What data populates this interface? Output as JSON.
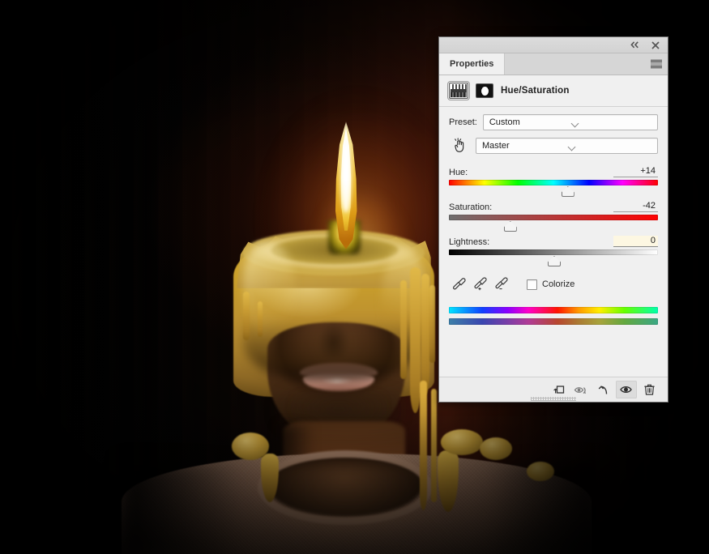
{
  "app": {
    "panel_title": "Properties",
    "titlebar": {
      "collapse_icon": "double-left-chevron-icon",
      "close_icon": "close-icon",
      "menu_icon": "panel-menu-icon"
    }
  },
  "adjustment": {
    "icon_adjustment": "hue-saturation-adjustment-icon",
    "icon_mask": "layer-mask-icon",
    "title": "Hue/Saturation"
  },
  "preset": {
    "label": "Preset:",
    "value": "Custom",
    "caret_icon": "chevron-down-icon"
  },
  "channel": {
    "targeted_adjustment_icon": "on-image-adjustment-hand-icon",
    "value": "Master",
    "caret_icon": "chevron-down-icon"
  },
  "sliders": [
    {
      "label": "Hue:",
      "value": "+14",
      "thumb_pct": 56.5,
      "highlight": false
    },
    {
      "label": "Saturation:",
      "value": "-42",
      "thumb_pct": 29.0,
      "highlight": false
    },
    {
      "label": "Lightness:",
      "value": "0",
      "thumb_pct": 50.0,
      "highlight": true
    }
  ],
  "tools": {
    "eyedropper": "eyedropper-icon",
    "eyedropper_add": "eyedropper-add-icon",
    "eyedropper_subtract": "eyedropper-subtract-icon",
    "colorize_label": "Colorize",
    "colorize_checked": false
  },
  "spectrum": {
    "top_label": "source-hue-spectrum",
    "bottom_label": "result-hue-spectrum"
  },
  "footer": {
    "buttons": [
      {
        "name": "clip-to-layer-button",
        "icon": "clip-to-layer-icon",
        "active": false
      },
      {
        "name": "view-previous-state-button",
        "icon": "eye-previous-state-icon",
        "active": false
      },
      {
        "name": "reset-button",
        "icon": "reset-arrow-icon",
        "active": false
      },
      {
        "name": "toggle-visibility-button",
        "icon": "eye-icon",
        "active": true
      },
      {
        "name": "delete-button",
        "icon": "trash-icon",
        "active": false
      }
    ],
    "resize_grip": "resize-grip"
  },
  "artwork": {
    "name": "candle-head-photo-composite",
    "description": "Surreal composite of a man's head merged with a melting lit candle, wax dripping onto a textured sweater, dark red backdrop"
  }
}
